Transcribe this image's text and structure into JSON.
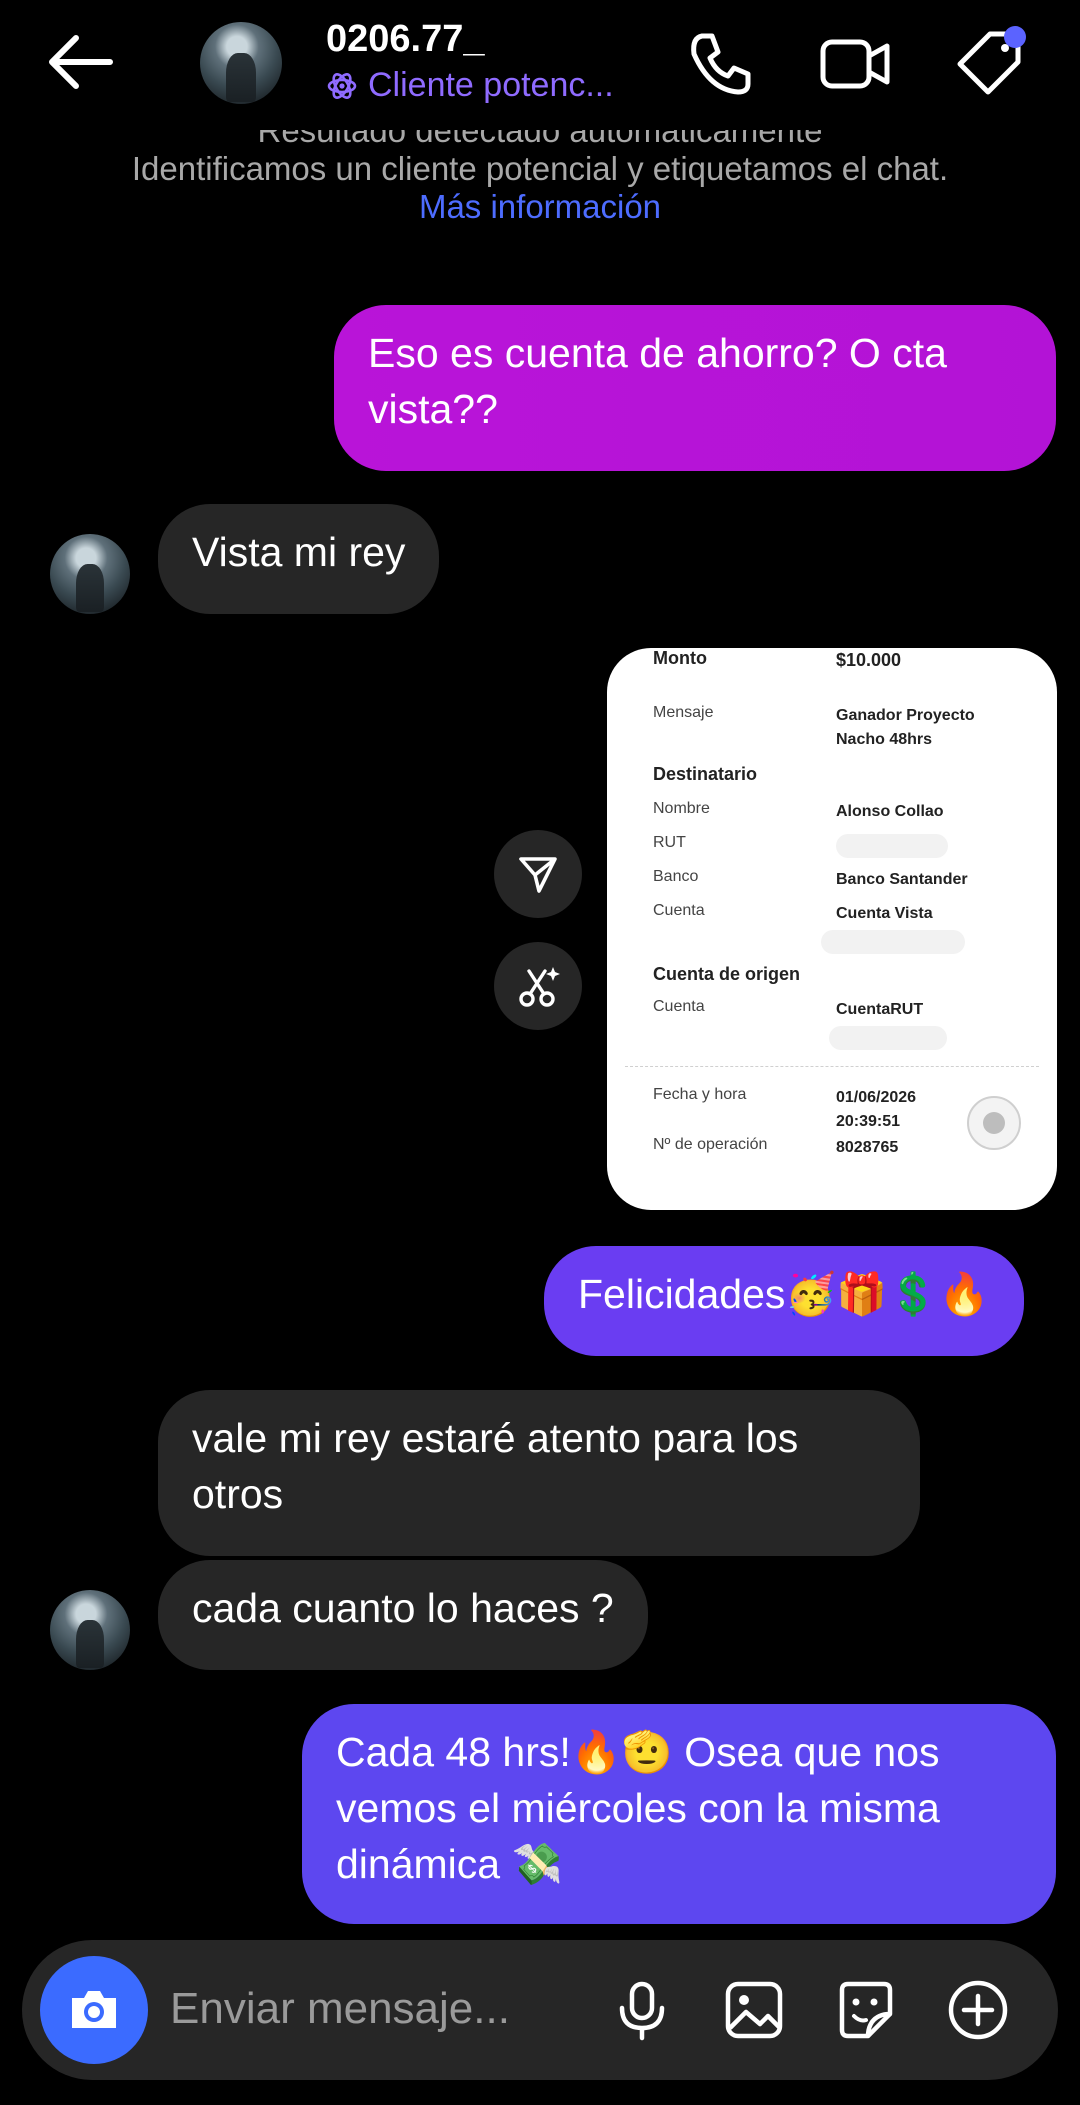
{
  "header": {
    "back_icon": "arrow-left-icon",
    "contact_name": "0206.77_",
    "contact_label": "Cliente potenc...",
    "icons": [
      "phone-icon",
      "video-camera-icon",
      "tag-icon"
    ],
    "accent": "#8f6bff"
  },
  "notice": {
    "clipped_line": "Resultado detectado automáticamente",
    "text": "Identificamos un cliente potencial y etiquetamos el chat.",
    "link": "Más información"
  },
  "messages": [
    {
      "from": "me",
      "text": "Eso es cuenta de ahorro? O cta vista??"
    },
    {
      "from": "them",
      "text": "Vista mi rey"
    },
    {
      "from": "me",
      "type": "image",
      "receipt": {
        "monto_label": "Monto",
        "monto_value": "$10.000",
        "mensaje_label": "Mensaje",
        "mensaje_value": "Ganador Proyecto Nacho 48hrs",
        "destinatario_heading": "Destinatario",
        "nombre_label": "Nombre",
        "nombre_value": "Alonso Collao",
        "rut_label": "RUT",
        "banco_label": "Banco",
        "banco_value": "Banco Santander",
        "cuenta_label": "Cuenta",
        "cuenta_value": "Cuenta Vista",
        "origen_heading": "Cuenta de origen",
        "origen_cuenta_label": "Cuenta",
        "origen_cuenta_value": "CuentaRUT",
        "fecha_label": "Fecha y hora",
        "fecha_value": "01/06/2026 20:39:51",
        "operacion_label": "Nº de operación",
        "operacion_value": "8028765"
      }
    },
    {
      "from": "me",
      "text": "Felicidades🥳🎁💲🔥"
    },
    {
      "from": "them",
      "text": "vale mi rey estaré atento para los otros"
    },
    {
      "from": "them",
      "text": "cada cuanto lo haces ?"
    },
    {
      "from": "me",
      "text": "Cada 48 hrs!🔥🫡 Osea que nos vemos el miércoles con la misma dinámica 💸"
    }
  ],
  "composer": {
    "placeholder": "Enviar mensaje...",
    "icons": [
      "camera-icon",
      "microphone-icon",
      "gallery-icon",
      "sticker-icon",
      "plus-icon"
    ]
  }
}
